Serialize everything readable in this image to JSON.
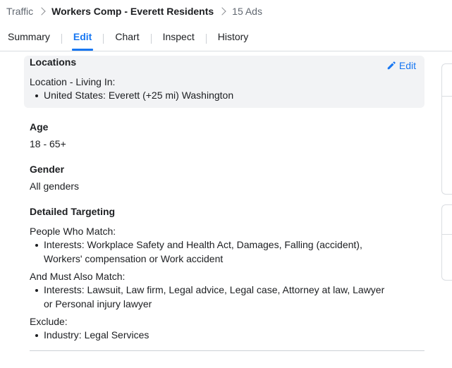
{
  "breadcrumb": {
    "root": "Traffic",
    "current": "Workers Comp - Everett Residents",
    "count": "15 Ads"
  },
  "tabs": [
    {
      "label": "Summary",
      "active": false
    },
    {
      "label": "Edit",
      "active": true
    },
    {
      "label": "Chart",
      "active": false
    },
    {
      "label": "Inspect",
      "active": false
    },
    {
      "label": "History",
      "active": false
    }
  ],
  "locations": {
    "title": "Locations",
    "edit_label": "Edit",
    "subheading": "Location - Living In:",
    "items": [
      "United States: Everett (+25 mi) Washington"
    ]
  },
  "age": {
    "title": "Age",
    "value": "18 - 65+"
  },
  "gender": {
    "title": "Gender",
    "value": "All genders"
  },
  "detailed_targeting": {
    "title": "Detailed Targeting",
    "match_label": "People Who Match:",
    "match_line1": "Interests: Workplace Safety and Health Act, Damages, Falling (accident),",
    "match_line2": "Workers' compensation or Work accident",
    "also_label": "And Must Also Match:",
    "also_line1": "Interests: Lawsuit, Law firm, Legal advice, Legal case, Attorney at law, Lawyer",
    "also_line2": "or Personal injury lawyer",
    "exclude_label": "Exclude:",
    "exclude_item": "Industry: Legal Services"
  },
  "colors": {
    "accent": "#1877f2",
    "card_bg": "#f2f3f5"
  }
}
